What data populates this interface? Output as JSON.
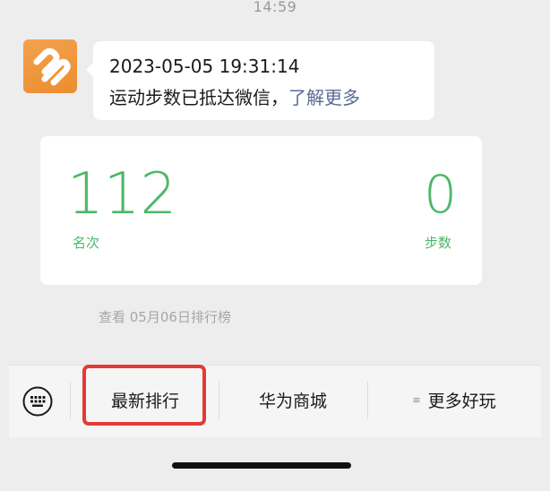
{
  "chat": {
    "timestamp": "14:59"
  },
  "message": {
    "datetime": "2023-05-05 19:31:14",
    "text": "运动步数已抵达微信，",
    "link_label": "了解更多"
  },
  "stats": {
    "rank_value": "112",
    "rank_label": "名次",
    "steps_value": "0",
    "steps_label": "步数"
  },
  "ranking_link": "查看 05月06日排行榜",
  "menu": {
    "keyboard_icon": "keyboard-icon",
    "items": [
      {
        "label": "最新排行"
      },
      {
        "label": "华为商城"
      },
      {
        "label": "更多好玩",
        "icon": "menu-lines-icon"
      }
    ]
  },
  "colors": {
    "accent_green": "#4cb868",
    "link_blue": "#576b95",
    "highlight_red": "#e23b36",
    "avatar_orange": "#ec8d2f"
  }
}
